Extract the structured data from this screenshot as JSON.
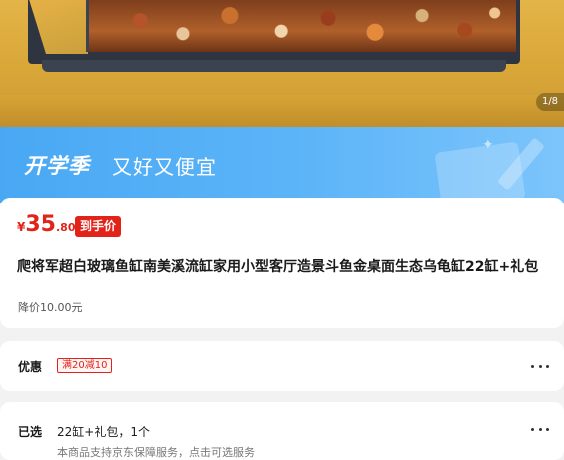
{
  "gallery": {
    "counter": "1/8"
  },
  "banner": {
    "title": "开学季",
    "subtitle": "又好又便宜"
  },
  "product": {
    "price": {
      "currency": "¥",
      "integer": "35",
      "decimal": ".80"
    },
    "price_badge": "到手价",
    "title": "爬将军超白玻璃鱼缸南美溪流缸家用小型客厅造景斗鱼金桌面生态乌龟缸22缸+礼包",
    "price_drop": "降价10.00元"
  },
  "promo": {
    "label": "优惠",
    "coupon": "满20减10"
  },
  "selected": {
    "label": "已选",
    "value": "22缸+礼包，1个",
    "note": "本商品支持京东保障服务，点击可选服务"
  },
  "colors": {
    "accent_red": "#e2231a",
    "banner_blue": "#49a8f4"
  }
}
